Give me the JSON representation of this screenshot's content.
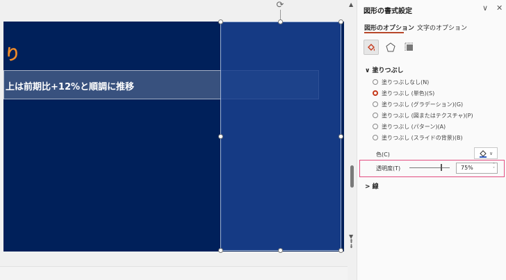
{
  "slide": {
    "title_fragment": "り",
    "strip_text": "上は前期比+12%と順調に推移"
  },
  "pane": {
    "title": "図形の書式設定",
    "collapse_glyph": "∨",
    "close_glyph": "✕",
    "tabs": [
      {
        "label": "図形のオプション",
        "active": true
      },
      {
        "label": "文字のオプション",
        "active": false
      }
    ],
    "fill_section": {
      "header": "∨ 塗りつぶし",
      "options": [
        {
          "label": "塗りつぶしなし(N)",
          "checked": false
        },
        {
          "label": "塗りつぶし (単色)(S)",
          "checked": true
        },
        {
          "label": "塗りつぶし (グラデーション)(G)",
          "checked": false
        },
        {
          "label": "塗りつぶし (図またはテクスチャ)(P)",
          "checked": false
        },
        {
          "label": "塗りつぶし (パターン)(A)",
          "checked": false
        },
        {
          "label": "塗りつぶし (スライドの背景)(B)",
          "checked": false
        }
      ],
      "color_label": "色(C)",
      "transparency_label": "透明度(T)",
      "transparency_value": "75%",
      "transparency_fraction": 0.75
    },
    "line_section": {
      "header": "> 線"
    }
  },
  "colors": {
    "slide_bg": "#00205a",
    "accent": "#f28c28",
    "tab_underline": "#b7472a",
    "highlight": "#e34b7f"
  }
}
